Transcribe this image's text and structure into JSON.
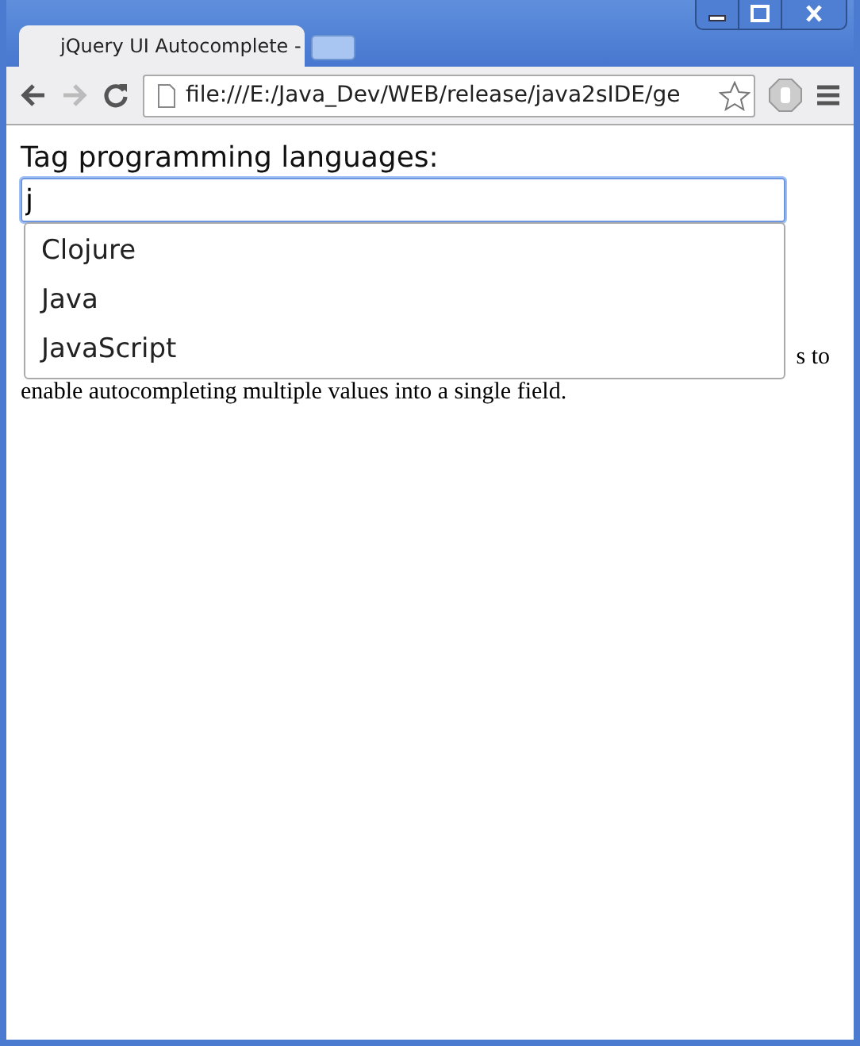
{
  "browser": {
    "tabs": [
      {
        "title": "jQuery UI Autocomplete -",
        "selected": true
      },
      {
        "kind": "new",
        "selected": false
      }
    ],
    "address": "file:///E:/Java_Dev/WEB/release/java2sIDE/ge",
    "back_disabled": false,
    "forward_disabled": true
  },
  "page": {
    "label": "Tag programming languages:",
    "field_value": "j",
    "suggestions": [
      "Clojure",
      "Java",
      "JavaScript"
    ],
    "hidden_text_end": "s to",
    "description_line": "enable autocompleting multiple values into a single field."
  }
}
